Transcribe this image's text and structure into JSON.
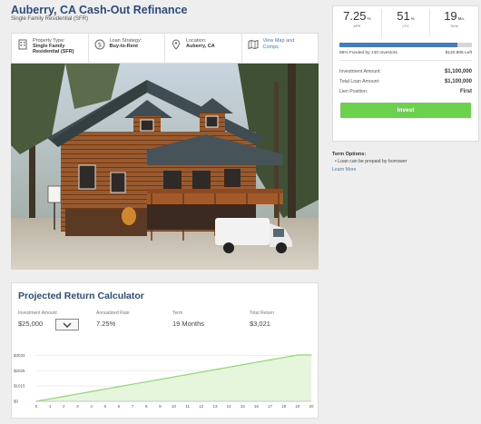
{
  "header": {
    "title": "Auberry, CA Cash-Out Refinance",
    "subtitle": "Single Family Residential (SFR)"
  },
  "info": {
    "property_label": "Property Type:",
    "property_value": "Single Family Residential (SFR)",
    "loan_label": "Loan Strategy:",
    "loan_value": "Buy-to-Rent",
    "location_label": "Location:",
    "location_value": "Auberry, CA",
    "map_link": "View Map and Comps"
  },
  "stats": {
    "apr_value": "7.25",
    "apr_unit": "%",
    "apr_label": "APR",
    "ltv_value": "51",
    "ltv_unit": "%",
    "ltv_label": "LTV",
    "term_value": "19",
    "term_unit": "Mo.",
    "term_label": "Term",
    "funded_pct": 89,
    "funded_text": "89% Funded by 140 Investors",
    "left_text": "$120,906 Left",
    "investment_label": "Investment Amount:",
    "investment_value": "$1,100,000",
    "total_loan_label": "Total Loan Amount:",
    "total_loan_value": "$1,100,000",
    "lien_label": "Lien Position:",
    "lien_value": "First",
    "invest_button": "Invest"
  },
  "term_options": {
    "title": "Term Options:",
    "item": "Loan can be prepaid by borrower",
    "learn_more": "Learn More"
  },
  "calculator": {
    "title": "Projected Return Calculator",
    "investment_label": "Investment Amount",
    "investment_value": "$25,000",
    "rate_label": "Annualized Rate",
    "rate_value": "7.25%",
    "term_label": "Term",
    "term_value": "19 Months",
    "total_label": "Total Return",
    "total_value": "$3,021"
  },
  "colors": {
    "title_blue": "#2f4a7a",
    "link_blue": "#3a7bc8",
    "progress_blue": "#3d7ec9",
    "invest_green": "#6bd24e",
    "chart_line": "#8ed86f",
    "chart_fill": "#e6f6dd"
  },
  "chart_data": {
    "type": "area",
    "x": [
      0,
      1,
      2,
      3,
      4,
      5,
      6,
      7,
      8,
      9,
      10,
      11,
      12,
      13,
      14,
      15,
      16,
      17,
      18,
      19,
      20
    ],
    "y": [
      0,
      159,
      318,
      477,
      636,
      795,
      954,
      1113,
      1272,
      1431,
      1590,
      1749,
      1908,
      2067,
      2226,
      2385,
      2544,
      2703,
      2862,
      3021,
      3021
    ],
    "xticks": [
      "0",
      "1",
      "2",
      "3",
      "4",
      "5",
      "6",
      "7",
      "8",
      "9",
      "10",
      "11",
      "12",
      "13",
      "14",
      "15",
      "16",
      "17",
      "18",
      "19",
      "20"
    ],
    "yticks": [
      {
        "value": 0,
        "label": "$0"
      },
      {
        "value": 1000,
        "label": "$1015"
      },
      {
        "value": 2000,
        "label": "$2025"
      },
      {
        "value": 3000,
        "label": "$3033"
      }
    ],
    "ylim": [
      0,
      3200
    ],
    "grid": true
  }
}
